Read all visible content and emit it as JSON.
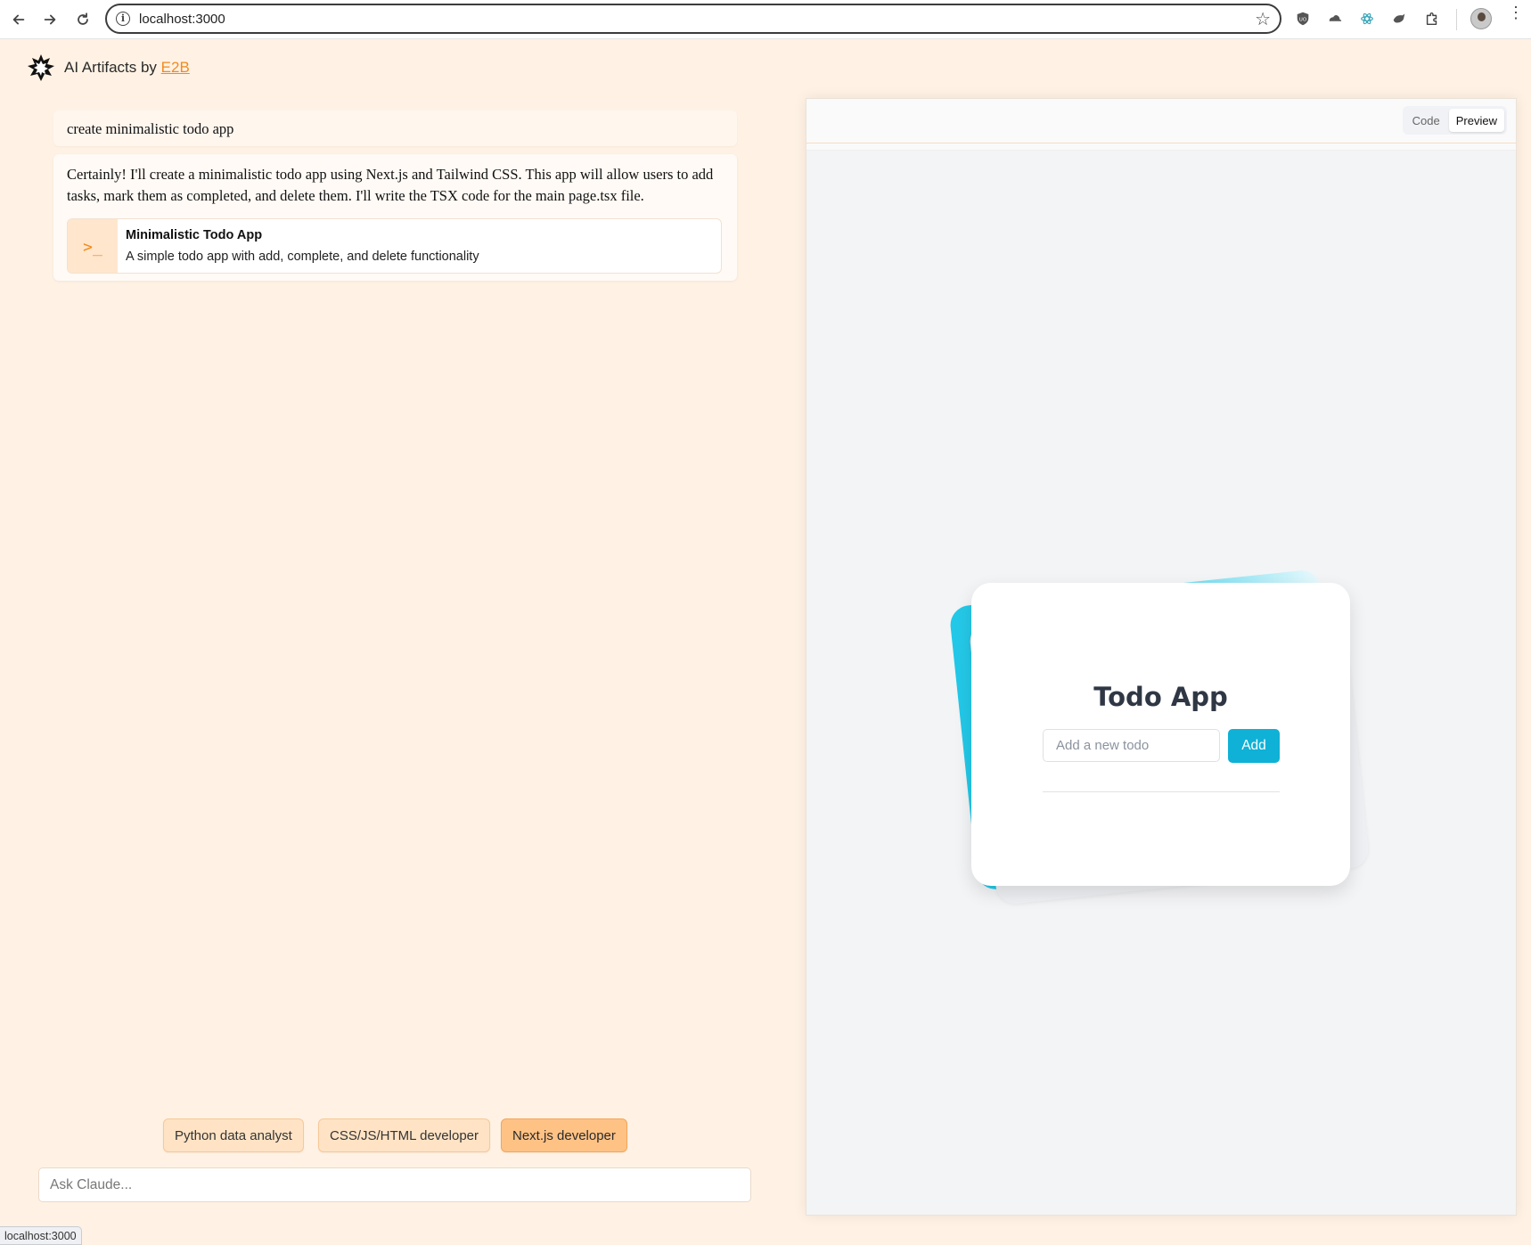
{
  "browser": {
    "url": "localhost:3000",
    "status_url": "localhost:3000"
  },
  "header": {
    "title_prefix": "AI Artifacts by",
    "title_link": "E2B"
  },
  "chat": {
    "user_message": "create minimalistic todo app",
    "assistant_message": "Certainly! I'll create a minimalistic todo app using Next.js and Tailwind CSS. This app will allow users to add tasks, mark them as completed, and delete them. I'll write the TSX code for the main page.tsx file.",
    "artifact": {
      "icon": "terminal-icon",
      "title": "Minimalistic Todo App",
      "description": "A simple todo app with add, complete, and delete functionality"
    }
  },
  "personas": [
    {
      "label": "Python data analyst",
      "active": false
    },
    {
      "label": "CSS/JS/HTML developer",
      "active": false
    },
    {
      "label": "Next.js developer",
      "active": true
    }
  ],
  "input": {
    "placeholder": "Ask Claude..."
  },
  "panel": {
    "tabs": [
      "Code",
      "Preview"
    ],
    "selected_tab": "Preview"
  },
  "preview": {
    "title": "Todo App",
    "input_placeholder": "Add a new todo",
    "add_label": "Add"
  },
  "colors": {
    "page_bg": "#fff2e4",
    "accent": "#f28a1c",
    "todo_button": "#0fb1d6",
    "chip_active": "#ffc285"
  }
}
